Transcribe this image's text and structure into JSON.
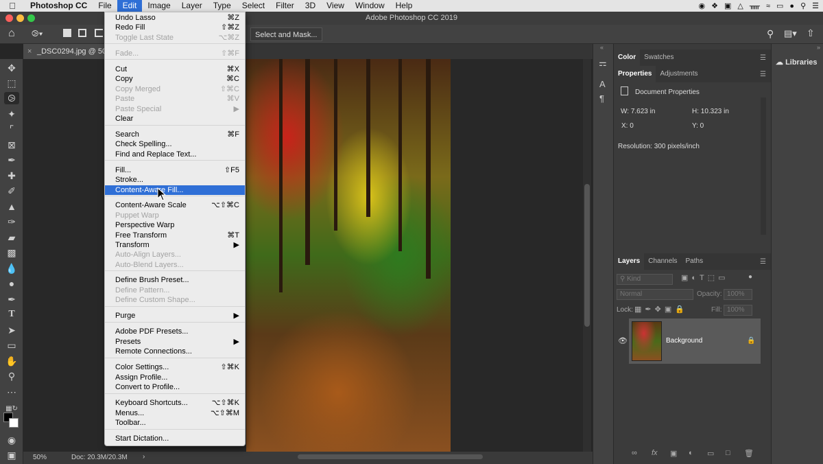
{
  "menubar": {
    "app_name": "Photoshop CC",
    "items": [
      "File",
      "Edit",
      "Image",
      "Layer",
      "Type",
      "Select",
      "Filter",
      "3D",
      "View",
      "Window",
      "Help"
    ],
    "active": "Edit"
  },
  "window": {
    "title": "Adobe Photoshop CC 2019"
  },
  "options_bar": {
    "select_and_mask_label": "Select and Mask..."
  },
  "document_tab": {
    "label": "_DSC0294.jpg @ 50%"
  },
  "status_bar": {
    "zoom": "50%",
    "doc_size": "Doc: 20.3M/20.3M"
  },
  "edit_menu": {
    "items": [
      {
        "label": "Undo Lasso",
        "shortcut": "⌘Z",
        "disabled": false
      },
      {
        "label": "Redo Fill",
        "shortcut": "⇧⌘Z",
        "disabled": false
      },
      {
        "label": "Toggle Last State",
        "shortcut": "⌥⌘Z",
        "disabled": true
      },
      {
        "label": "Fade...",
        "shortcut": "⇧⌘F",
        "disabled": true
      },
      {
        "label": "Cut",
        "shortcut": "⌘X",
        "disabled": false
      },
      {
        "label": "Copy",
        "shortcut": "⌘C",
        "disabled": false
      },
      {
        "label": "Copy Merged",
        "shortcut": "⇧⌘C",
        "disabled": true
      },
      {
        "label": "Paste",
        "shortcut": "⌘V",
        "disabled": true
      },
      {
        "label": "Paste Special",
        "shortcut": "▶",
        "disabled": true
      },
      {
        "label": "Clear",
        "shortcut": "",
        "disabled": false
      },
      {
        "label": "Search",
        "shortcut": "⌘F",
        "disabled": false
      },
      {
        "label": "Check Spelling...",
        "shortcut": "",
        "disabled": false
      },
      {
        "label": "Find and Replace Text...",
        "shortcut": "",
        "disabled": false
      },
      {
        "label": "Fill...",
        "shortcut": "⇧F5",
        "disabled": false
      },
      {
        "label": "Stroke...",
        "shortcut": "",
        "disabled": false
      },
      {
        "label": "Content-Aware Fill...",
        "shortcut": "",
        "disabled": false,
        "highlighted": true
      },
      {
        "label": "Content-Aware Scale",
        "shortcut": "⌥⇧⌘C",
        "disabled": false
      },
      {
        "label": "Puppet Warp",
        "shortcut": "",
        "disabled": true
      },
      {
        "label": "Perspective Warp",
        "shortcut": "",
        "disabled": false
      },
      {
        "label": "Free Transform",
        "shortcut": "⌘T",
        "disabled": false
      },
      {
        "label": "Transform",
        "shortcut": "▶",
        "disabled": false
      },
      {
        "label": "Auto-Align Layers...",
        "shortcut": "",
        "disabled": true
      },
      {
        "label": "Auto-Blend Layers...",
        "shortcut": "",
        "disabled": true
      },
      {
        "label": "Define Brush Preset...",
        "shortcut": "",
        "disabled": false
      },
      {
        "label": "Define Pattern...",
        "shortcut": "",
        "disabled": true
      },
      {
        "label": "Define Custom Shape...",
        "shortcut": "",
        "disabled": true
      },
      {
        "label": "Purge",
        "shortcut": "▶",
        "disabled": false
      },
      {
        "label": "Adobe PDF Presets...",
        "shortcut": "",
        "disabled": false
      },
      {
        "label": "Presets",
        "shortcut": "▶",
        "disabled": false
      },
      {
        "label": "Remote Connections...",
        "shortcut": "",
        "disabled": false
      },
      {
        "label": "Color Settings...",
        "shortcut": "⇧⌘K",
        "disabled": false
      },
      {
        "label": "Assign Profile...",
        "shortcut": "",
        "disabled": false
      },
      {
        "label": "Convert to Profile...",
        "shortcut": "",
        "disabled": false
      },
      {
        "label": "Keyboard Shortcuts...",
        "shortcut": "⌥⇧⌘K",
        "disabled": false
      },
      {
        "label": "Menus...",
        "shortcut": "⌥⇧⌘M",
        "disabled": false
      },
      {
        "label": "Toolbar...",
        "shortcut": "",
        "disabled": false
      },
      {
        "label": "Start Dictation...",
        "shortcut": "",
        "disabled": false
      }
    ]
  },
  "color_panel": {
    "tabs": [
      "Color",
      "Swatches"
    ]
  },
  "properties_panel": {
    "tabs": [
      "Properties",
      "Adjustments"
    ],
    "section_title": "Document Properties",
    "w": "W: 7.623 in",
    "h": "H: 10.323 in",
    "x": "X: 0",
    "y": "Y: 0",
    "resolution": "Resolution: 300 pixels/inch"
  },
  "layers_panel": {
    "tabs": [
      "Layers",
      "Channels",
      "Paths"
    ],
    "filter_placeholder": "Kind",
    "blend_mode": "Normal",
    "opacity_label": "Opacity:",
    "opacity_value": "100%",
    "lock_label": "Lock:",
    "fill_label": "Fill:",
    "fill_value": "100%",
    "layer_name": "Background"
  },
  "libraries": {
    "label": "Libraries"
  },
  "colors": {
    "accent": "#2f6fd6",
    "menu_bg": "#ececec",
    "panel_bg": "#3b3b3b"
  }
}
